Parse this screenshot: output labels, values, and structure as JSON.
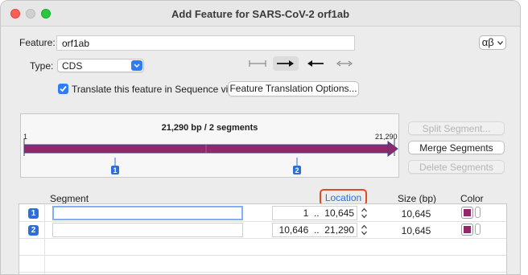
{
  "window": {
    "title": "Add Feature for SARS-CoV-2 orf1ab"
  },
  "feature": {
    "label": "Feature:",
    "name": "orf1ab",
    "alphabet_button": "αβ"
  },
  "type": {
    "label": "Type:",
    "selected": "CDS"
  },
  "translate": {
    "checked": true,
    "label": "Translate this feature in Sequence view",
    "options_button": "Feature Translation Options..."
  },
  "map": {
    "summary": "21,290 bp  /  2 segments",
    "start_label": "1",
    "end_label": "21,290",
    "segment_markers": [
      "1",
      "2"
    ],
    "segment_ranges": [
      [
        1,
        10645
      ],
      [
        10646,
        21290
      ]
    ],
    "total_bp": 21290
  },
  "segment_buttons": {
    "split": "Split Segment...",
    "merge": "Merge Segments",
    "delete": "Delete Segments"
  },
  "table": {
    "headers": {
      "segment": "Segment",
      "location": "Location",
      "size": "Size (bp)",
      "color": "Color"
    },
    "rows": [
      {
        "num": "1",
        "name": "",
        "location": "1  ..  10,645",
        "size": "10,645",
        "color": "#93276a"
      },
      {
        "num": "2",
        "name": "",
        "location": "10,646  ..  21,290",
        "size": "10,645",
        "color": "#93276a"
      }
    ]
  },
  "colors": {
    "feature": "#93276a",
    "accent": "#2d7df6",
    "highlight": "#e04a25"
  }
}
